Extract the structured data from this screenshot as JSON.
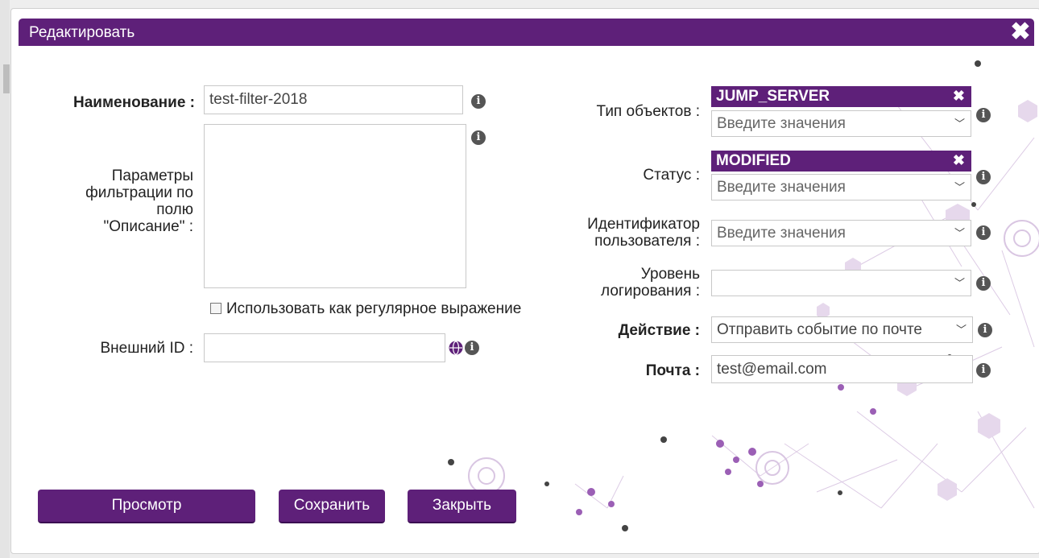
{
  "dialog": {
    "title": "Редактировать"
  },
  "form": {
    "name_label": "Наименование :",
    "name_value": "test-filter-2018",
    "desc_label_lines": [
      "Параметры",
      "фильтрации по",
      "полю",
      "\"Описание\" :"
    ],
    "desc_value": "",
    "regex_label": "Использовать как регулярное выражение",
    "regex_checked": false,
    "external_id_label": "Внешний ID :",
    "external_id_value": "",
    "object_type_label": "Тип объектов :",
    "object_type_tag": "JUMP_SERVER",
    "object_type_placeholder": "Введите значения",
    "status_label": "Статус :",
    "status_tag": "MODIFIED",
    "status_placeholder": "Введите значения",
    "user_id_label_lines": [
      "Идентификатор",
      "пользователя :"
    ],
    "user_id_placeholder": "Введите значения",
    "log_level_label_lines": [
      "Уровень",
      "логирования :"
    ],
    "log_level_value": "",
    "action_label": "Действие :",
    "action_value": "Отправить событие по почте",
    "email_label": "Почта :",
    "email_value": "test@email.com"
  },
  "buttons": {
    "preview": "Просмотр",
    "save": "Сохранить",
    "close": "Закрыть"
  },
  "colors": {
    "accent": "#5e2079",
    "info_icon": "#555555"
  }
}
